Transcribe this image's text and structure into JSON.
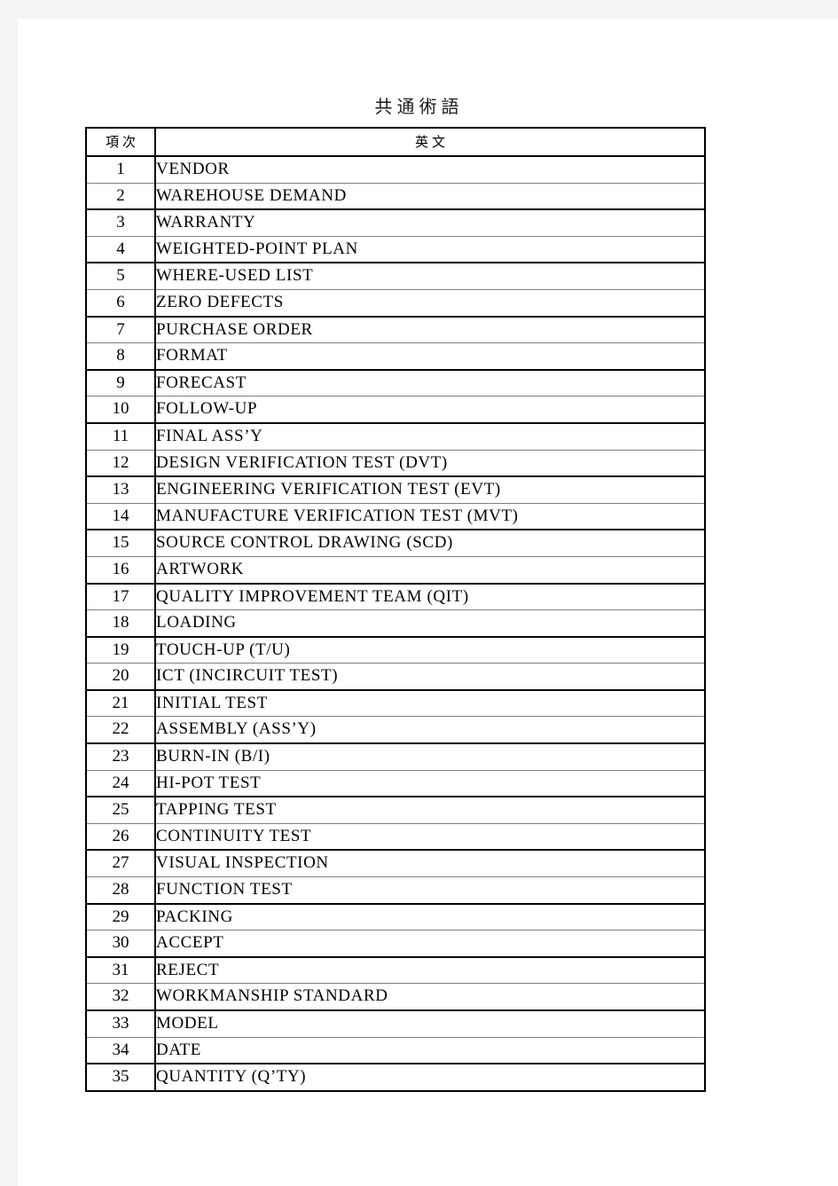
{
  "document": {
    "title": "共通術語"
  },
  "table": {
    "headers": {
      "no": "項次",
      "english": "英文"
    },
    "rows": [
      {
        "no": "1",
        "english": "VENDOR",
        "color": "black"
      },
      {
        "no": "2",
        "english": "WAREHOUSE DEMAND",
        "color": "black"
      },
      {
        "no": "3",
        "english": "WARRANTY",
        "color": "black"
      },
      {
        "no": "4",
        "english": "WEIGHTED-POINT PLAN",
        "color": "black"
      },
      {
        "no": "5",
        "english": "WHERE-USED LIST",
        "color": "black"
      },
      {
        "no": "6",
        "english": "ZERO DEFECTS",
        "color": "black"
      },
      {
        "no": "7",
        "english": "PURCHASE ORDER",
        "color": "black"
      },
      {
        "no": "8",
        "english": "FORMAT",
        "color": "black"
      },
      {
        "no": "9",
        "english": "FORECAST",
        "color": "black"
      },
      {
        "no": "10",
        "english": "FOLLOW-UP",
        "color": "black"
      },
      {
        "no": "11",
        "english": "FINAL ASS’Y",
        "color": "black"
      },
      {
        "no": "12",
        "english": "DESIGN VERIFICATION TEST (DVT)",
        "color": "red"
      },
      {
        "no": "13",
        "english": "ENGINEERING VERIFICATION TEST (EVT)",
        "color": "black"
      },
      {
        "no": "14",
        "english": "MANUFACTURE VERIFICATION TEST (MVT)",
        "color": "black"
      },
      {
        "no": "15",
        "english": "SOURCE CONTROL DRAWING (SCD)",
        "color": "red"
      },
      {
        "no": "16",
        "english": "ARTWORK",
        "color": "red"
      },
      {
        "no": "17",
        "english": "QUALITY IMPROVEMENT TEAM (QIT)",
        "color": "black"
      },
      {
        "no": "18",
        "english": "LOADING",
        "color": "black"
      },
      {
        "no": "19",
        "english": "TOUCH-UP (T/U)",
        "color": "red"
      },
      {
        "no": "20",
        "english": "ICT (INCIRCUIT TEST)",
        "color": "red"
      },
      {
        "no": "21",
        "english": "INITIAL TEST",
        "color": "red"
      },
      {
        "no": "22",
        "english": "ASSEMBLY (ASS’Y)",
        "color": "black"
      },
      {
        "no": "23",
        "english": "BURN-IN (B/I)",
        "color": "black"
      },
      {
        "no": "24",
        "english": "HI-POT TEST",
        "color": "black"
      },
      {
        "no": "25",
        "english": "TAPPING TEST",
        "color": "red"
      },
      {
        "no": "26",
        "english": "CONTINUITY TEST",
        "color": "black"
      },
      {
        "no": "27",
        "english": "VISUAL INSPECTION",
        "color": "black"
      },
      {
        "no": "28",
        "english": "FUNCTION TEST",
        "color": "black"
      },
      {
        "no": "29",
        "english": "PACKING",
        "color": "black"
      },
      {
        "no": "30",
        "english": "ACCEPT",
        "color": "black"
      },
      {
        "no": "31",
        "english": "REJECT",
        "color": "black"
      },
      {
        "no": "32",
        "english": "WORKMANSHIP STANDARD",
        "color": "red"
      },
      {
        "no": "33",
        "english": "MODEL",
        "color": "black"
      },
      {
        "no": "34",
        "english": "DATE",
        "color": "black"
      },
      {
        "no": "35",
        "english": "QUANTITY (Q’TY)",
        "color": "black"
      }
    ]
  },
  "colors": {
    "highlight": "#ff0000",
    "text": "#000000",
    "border": "#000000",
    "border_light": "#808080"
  }
}
